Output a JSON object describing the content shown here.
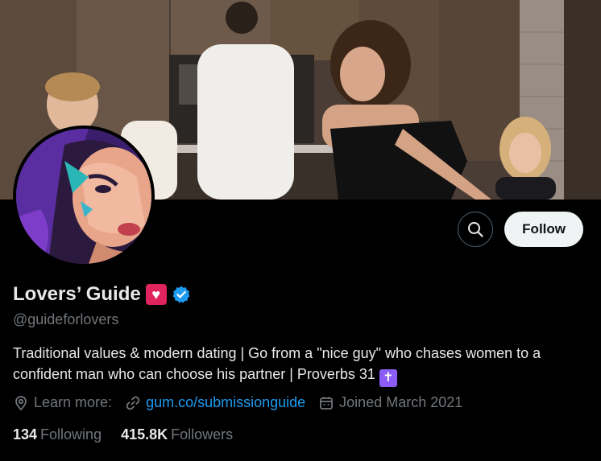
{
  "profile": {
    "display_name": "Lovers’ Guide",
    "heart_emoji": "♥",
    "handle": "@guideforlovers",
    "bio": "Traditional values & modern dating | Go from a \"nice guy\" who chases women to a confident man who can choose his partner | Proverbs 31",
    "bio_emoji": "✝",
    "verified_icon": "verified-badge-icon"
  },
  "actions": {
    "search_icon": "search-icon",
    "follow_label": "Follow"
  },
  "meta": {
    "learn_more_label": "Learn more:",
    "link_text": "gum.co/submissionguide",
    "joined_text": "Joined March 2021"
  },
  "stats": {
    "following_count": "134",
    "following_label": "Following",
    "followers_count": "415.8K",
    "followers_label": "Followers"
  },
  "colors": {
    "background": "#000000",
    "primary_text": "#e7e9ea",
    "secondary_text": "#71767b",
    "link": "#1d9bf0",
    "verified": "#1d9bf0",
    "follow_button_bg": "#eff3f4"
  }
}
